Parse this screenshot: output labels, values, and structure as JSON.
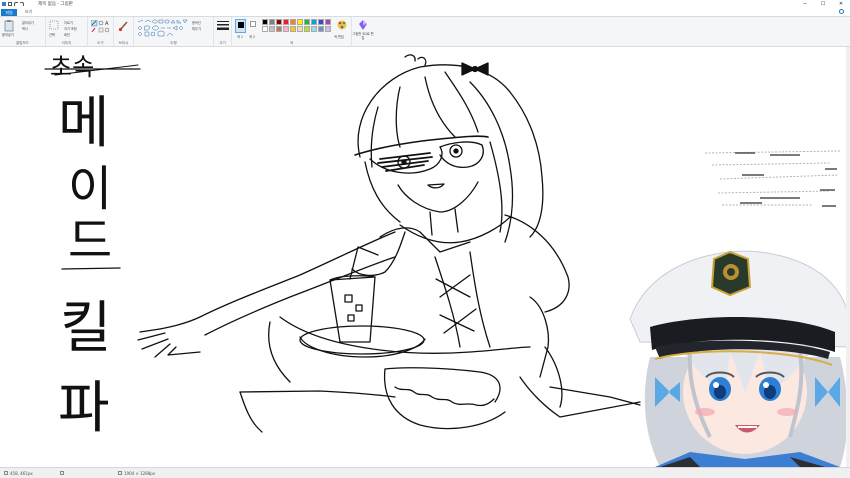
{
  "window": {
    "title": "제목 없음 - 그림판",
    "controls": {
      "minimize": "─",
      "maximize": "☐",
      "close": "✕"
    }
  },
  "tabs": {
    "file": "파일",
    "view": "보기"
  },
  "ribbon": {
    "clipboard": {
      "paste": "붙여넣기",
      "cut": "잘라내기",
      "copy": "복사",
      "label": "클립보드"
    },
    "image": {
      "select": "선택",
      "crop": "자르기",
      "resize": "크기 조정",
      "rotate": "회전",
      "label": "이미지"
    },
    "tools": {
      "label": "도구"
    },
    "brushes": {
      "label": "브러시"
    },
    "shapes": {
      "outline": "윤곽선",
      "fill": "채우기",
      "label": "도형"
    },
    "size": {
      "label": "크기"
    },
    "colors": {
      "color1": "색 1",
      "color2": "색 2",
      "edit": "색 편집",
      "label": "색",
      "palette": [
        "#000000",
        "#7f7f7f",
        "#880015",
        "#ed1c24",
        "#ff7f27",
        "#fff200",
        "#22b14c",
        "#00a2e8",
        "#3f48cc",
        "#a349a4",
        "#ffffff",
        "#c3c3c3",
        "#b97a57",
        "#ffaec9",
        "#ffc90e",
        "#efe4b0",
        "#b5e61d",
        "#99d9ea",
        "#7092be",
        "#c8bfe7"
      ]
    },
    "paint3d": {
      "label": "그림판 3D로 편집"
    }
  },
  "canvas": {
    "vertical_text": [
      "메",
      "이",
      "드",
      "킬",
      "파"
    ],
    "crossed_word": "초속"
  },
  "status": {
    "position": "458, 461px",
    "size": "1904 × 1288px"
  },
  "colors": {
    "accent": "#1979ca",
    "ribbon_bg": "#f5f6f7"
  }
}
